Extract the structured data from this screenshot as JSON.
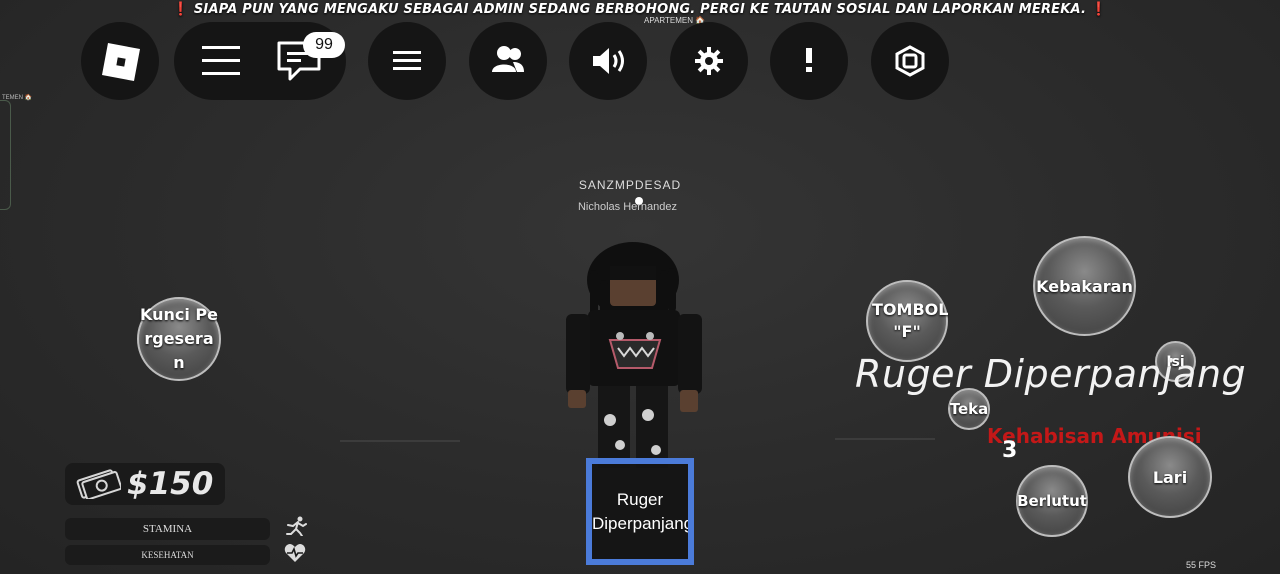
{
  "banner": {
    "warning_mark": "❗",
    "text": "SIAPA PUN YANG MENGAKU SEBAGAI ADMIN SEDANG BERBOHONG. PERGI KE TAUTAN SOSIAL DAN LAPORKAN MEREKA.",
    "sub_label": "APARTEMEN 🏠"
  },
  "topbar": {
    "roblox_logo": "roblox-logo-icon",
    "menu_icon": "hamburger-menu-icon",
    "chat_icon": "chat-icon",
    "chat_badge": "99",
    "leaderboard_icon": "list-icon",
    "players_icon": "players-icon",
    "volume_icon": "volume-icon",
    "settings_icon": "gear-icon",
    "report_icon": "exclamation-icon",
    "robux_icon": "robux-icon"
  },
  "left_edge": {
    "label": "TEMEN 🏠"
  },
  "player": {
    "username": "SANZMPDESAD",
    "display_name": "Nicholas Hernandez"
  },
  "buttons": {
    "shift_lock": "Kunci Pergeseran",
    "f_button": "TOMBOL \"F\"",
    "fire": "Kebakaran",
    "reload": "Isi",
    "press": "Teka",
    "run": "Lari",
    "crouch": "Berlutut"
  },
  "weapon": {
    "name": "Ruger Diperpanjang",
    "ammo_status": "Kehabisan Amunisi",
    "ammo_count": "3"
  },
  "hud": {
    "money": "$150",
    "stamina_label": "STAMINA",
    "health_label": "KESEHATAN",
    "fps": "55 FPS"
  },
  "hotbar": {
    "slot1_label": "Ruger Diperpanjang"
  },
  "colors": {
    "background": "#2a2a2a",
    "topbar": "#151515",
    "slot_border": "#4b7bd9",
    "ammo_warning": "#c41818"
  }
}
